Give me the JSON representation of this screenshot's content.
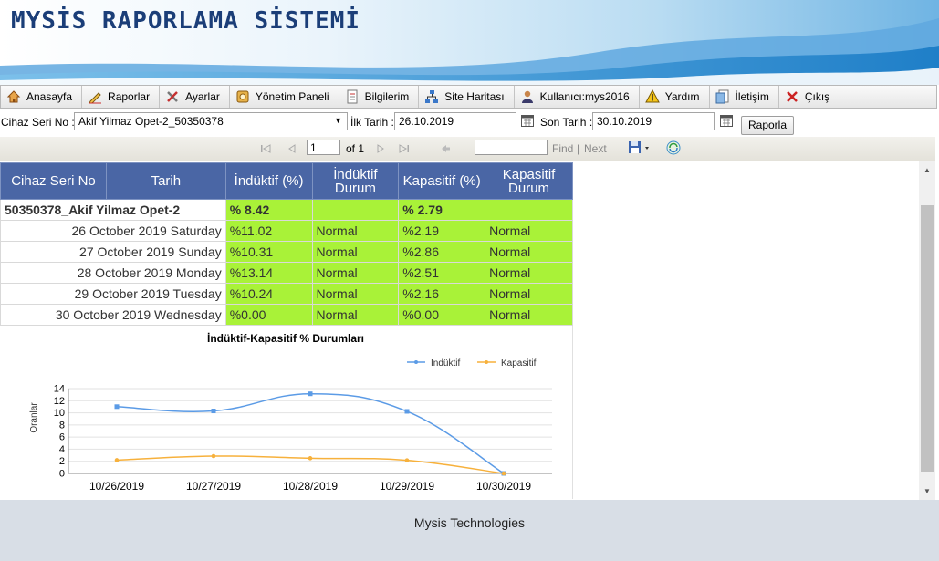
{
  "app_title": "MYSİS RAPORLAMA SİSTEMİ",
  "menu": [
    {
      "label": "Anasayfa",
      "icon": "home-icon"
    },
    {
      "label": "Raporlar",
      "icon": "pencil-icon"
    },
    {
      "label": "Ayarlar",
      "icon": "tools-icon"
    },
    {
      "label": "Yönetim Paneli",
      "icon": "panel-icon"
    },
    {
      "label": "Bilgilerim",
      "icon": "document-icon"
    },
    {
      "label": "Site Haritası",
      "icon": "sitemap-icon"
    },
    {
      "label": "Kullanıcı:mys2016",
      "icon": "user-icon"
    },
    {
      "label": "Yardım",
      "icon": "warning-icon"
    },
    {
      "label": "İletişim",
      "icon": "contact-icon"
    },
    {
      "label": "Çıkış",
      "icon": "close-icon"
    }
  ],
  "filters": {
    "device_label": "Cihaz Seri No :",
    "device_value": "Akif Yilmaz Opet-2_50350378",
    "start_label": "İlk Tarih :",
    "start_value": "26.10.2019",
    "end_label": "Son Tarih :",
    "end_value": "30.10.2019",
    "report_button": "Raporla"
  },
  "report_toolbar": {
    "page_value": "1",
    "of_label": "of 1",
    "find_label": "Find",
    "separator": "|",
    "next_label": "Next"
  },
  "table": {
    "headers": [
      "Cihaz Seri No",
      "Tarih",
      "İndüktif (%)",
      "İndüktif Durum",
      "Kapasitif (%)",
      "Kapasitif Durum"
    ],
    "group": {
      "name": "50350378_Akif Yilmaz Opet-2",
      "inductive": "% 8.42",
      "capacitive": "% 2.79"
    },
    "rows": [
      {
        "date": "26 October 2019 Saturday",
        "ind": "%11.02",
        "ind_status": "Normal",
        "cap": "%2.19",
        "cap_status": "Normal"
      },
      {
        "date": "27 October 2019 Sunday",
        "ind": "%10.31",
        "ind_status": "Normal",
        "cap": "%2.86",
        "cap_status": "Normal"
      },
      {
        "date": "28 October 2019 Monday",
        "ind": "%13.14",
        "ind_status": "Normal",
        "cap": "%2.51",
        "cap_status": "Normal"
      },
      {
        "date": "29 October 2019 Tuesday",
        "ind": "%10.24",
        "ind_status": "Normal",
        "cap": "%2.16",
        "cap_status": "Normal"
      },
      {
        "date": "30 October 2019 Wednesday",
        "ind": "%0.00",
        "ind_status": "Normal",
        "cap": "%0.00",
        "cap_status": "Normal"
      }
    ]
  },
  "chart_data": {
    "type": "line",
    "title": "İndüktif-Kapasitif % Durumları",
    "xlabel": "",
    "ylabel": "Oranlar",
    "categories": [
      "10/26/2019",
      "10/27/2019",
      "10/28/2019",
      "10/29/2019",
      "10/30/2019"
    ],
    "series": [
      {
        "name": "İndüktif",
        "values": [
          11.02,
          10.31,
          13.14,
          10.24,
          0.0
        ],
        "color": "#5b9be6"
      },
      {
        "name": "Kapasitif",
        "values": [
          2.19,
          2.86,
          2.51,
          2.16,
          0.0
        ],
        "color": "#f7b13c"
      }
    ],
    "ylim": [
      0,
      14
    ],
    "yticks": [
      0,
      2,
      4,
      6,
      8,
      10,
      12,
      14
    ],
    "grid": true,
    "legend": "top-right"
  },
  "footer": "Mysis Technologies",
  "colors": {
    "header_bg": "#4a66a5",
    "status_green": "#a9f238",
    "title_text": "#1b3e78",
    "footer_bg": "#d8dee6"
  }
}
